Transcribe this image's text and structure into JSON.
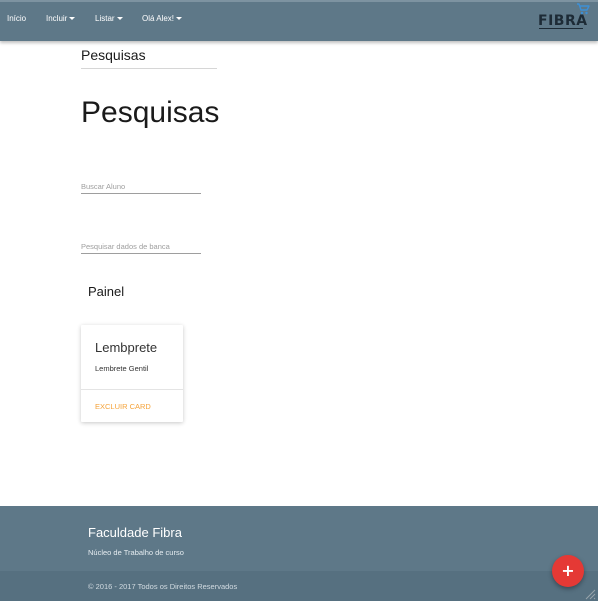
{
  "navbar": {
    "items": [
      {
        "label": "Início",
        "has_caret": false
      },
      {
        "label": "Incluir",
        "has_caret": true
      },
      {
        "label": "Listar",
        "has_caret": true
      },
      {
        "label": "Olá Alex!",
        "has_caret": true
      }
    ],
    "brand": "FIBRA",
    "cart_icon": "cart-icon"
  },
  "breadcrumb": {
    "title": "Pesquisas"
  },
  "page": {
    "heading": "Pesquisas"
  },
  "search": {
    "aluno_placeholder": "Buscar Aluno",
    "aluno_value": "",
    "banca_placeholder": "Pesquisar dados de banca",
    "banca_value": ""
  },
  "panel": {
    "title": "Painel"
  },
  "card": {
    "title": "Lembprete",
    "text": "Lembrete Gentil",
    "action": "EXCLUIR CARD"
  },
  "footer": {
    "title": "Faculdade Fibra",
    "subtitle": "Núcleo de Trabalho de curso",
    "copyright": "© 2016 - 2017 Todos os Direitos Reservados"
  },
  "fab": {
    "symbol": "+",
    "icon": "add-icon"
  },
  "colors": {
    "navbar": "#5e7888",
    "footer": "#5e7888",
    "footer_copy_bar": "#567080",
    "accent": "#f5a33a",
    "fab": "#e53935"
  }
}
